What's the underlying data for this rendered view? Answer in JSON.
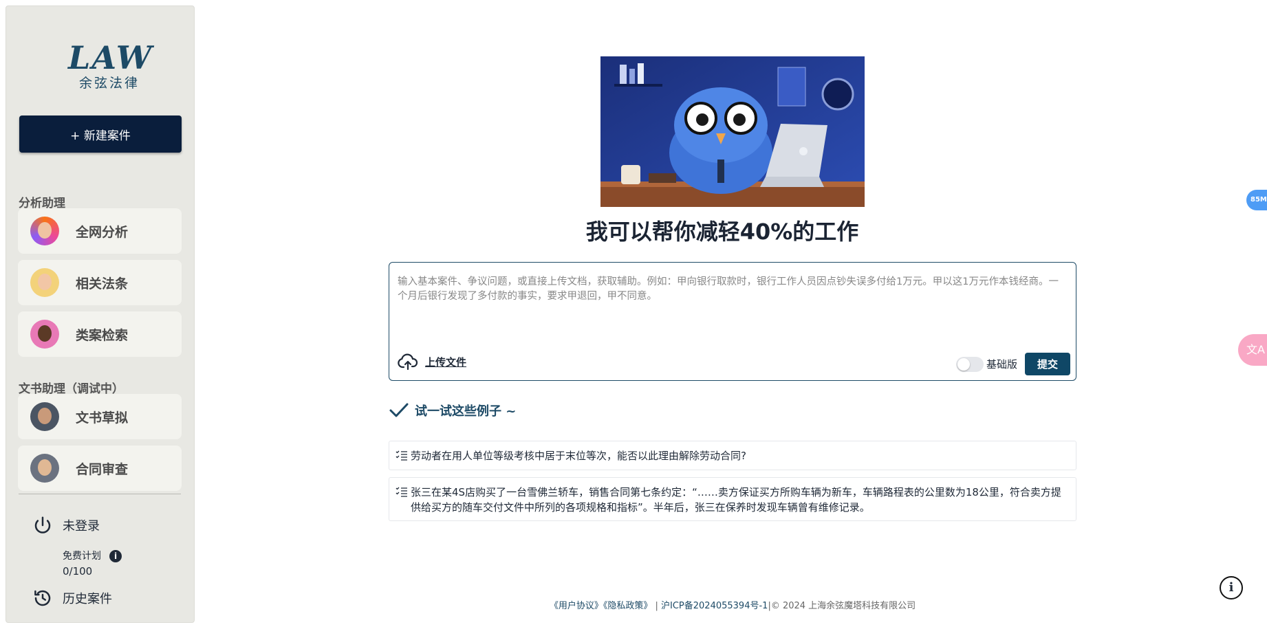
{
  "brand": {
    "logo_mark": "LAW",
    "logo_sub": "余弦法律"
  },
  "sidebar": {
    "new_case_label": "+ 新建案件",
    "analysis_section": "分析助理",
    "analysis_items": [
      {
        "label": "全网分析"
      },
      {
        "label": "相关法条"
      },
      {
        "label": "类案检索"
      }
    ],
    "document_section": "文书助理（调试中）",
    "document_items": [
      {
        "label": "文书草拟"
      },
      {
        "label": "合同审查"
      }
    ],
    "login_label": "未登录",
    "plan_name": "免费计划",
    "plan_usage": "0/100",
    "history_label": "历史案件"
  },
  "main": {
    "headline": "我可以帮你减轻40%的工作",
    "composer": {
      "placeholder": "输入基本案件、争议问题，或直接上传文档，获取辅助。例如：甲向银行取款时，银行工作人员因点钞失误多付给1万元。甲以这1万元作本钱经商。一个月后银行发现了多付款的事实，要求甲退回，甲不同意。",
      "upload_label": "上传文件",
      "toggle_label": "基础版",
      "toggle_on": false,
      "submit_label": "提交"
    },
    "examples_title": "试一试这些例子 ~",
    "examples": [
      {
        "text": "劳动者在用人单位等级考核中居于末位等次，能否以此理由解除劳动合同?"
      },
      {
        "text": "张三在某4S店购买了一台雪佛兰轿车，销售合同第七条约定：“……卖方保证买方所购车辆为新车，车辆路程表的公里数为18公里，符合卖方提供给买方的随车交付文件中所列的各项规格和指标”。半年后，张三在保养时发现车辆曾有维修记录。"
      }
    ]
  },
  "footer": {
    "user_agreement": "《用户协议》",
    "privacy_policy": "《隐私政策》",
    "separator": "|",
    "icp": "沪ICP备2024055394号-1",
    "copyright": "|© 2024 上海余弦魔塔科技有限公司"
  },
  "widgets": {
    "badge": "85M",
    "translate_glyph": "文A",
    "help_glyph": "i"
  },
  "colors": {
    "brand_navy": "#0a1e3c",
    "accent_blue": "#1d4a66",
    "submit_blue": "#0f4766",
    "sidebar_bg": "#e8e8e3"
  },
  "icons": {
    "login": "power-icon",
    "info": "info-icon",
    "history": "history-icon",
    "upload": "cloud-upload-icon",
    "check": "check-icon",
    "example": "list-icon"
  }
}
